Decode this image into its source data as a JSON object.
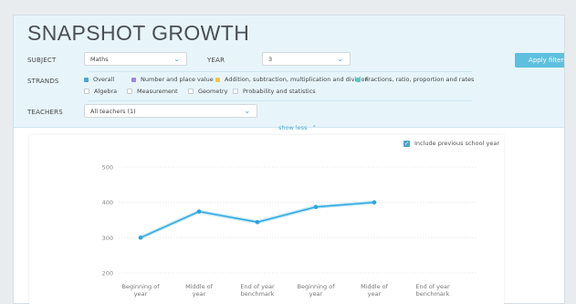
{
  "header": {
    "title": "SNAPSHOT GROWTH"
  },
  "filters": {
    "subject_label": "SUBJECT",
    "subject_value": "Maths",
    "year_label": "YEAR",
    "year_value": "3",
    "apply_label": "Apply filters",
    "strands_label": "STRANDS",
    "strands": [
      {
        "label": "Overall",
        "color": "#4ea6c7",
        "checked": true
      },
      {
        "label": "Number and place value",
        "color": "#9b86d6",
        "checked": true
      },
      {
        "label": "Addition, subtraction, multiplication and division",
        "color": "#f2c744",
        "checked": true
      },
      {
        "label": "Fractions, ratio, proportion and rates",
        "color": "#5cc7c2",
        "checked": true
      },
      {
        "label": "Algebra",
        "checked": false
      },
      {
        "label": "Measurement",
        "checked": false
      },
      {
        "label": "Geometry",
        "checked": false
      },
      {
        "label": "Probability and statistics",
        "checked": false
      }
    ],
    "teachers_label": "TEACHERS",
    "teachers_value": "All teachers (1)",
    "show_less": "show less"
  },
  "chart": {
    "include_previous_label": "Include previous school year",
    "include_previous_checked": true
  },
  "chart_data": {
    "type": "line",
    "categories": [
      [
        "Beginning of",
        "year"
      ],
      [
        "Middle of",
        "year"
      ],
      [
        "End of year",
        "benchmark"
      ],
      [
        "Beginning of",
        "year"
      ],
      [
        "Middle of",
        "year"
      ],
      [
        "End of year",
        "benchmark"
      ]
    ],
    "series": [
      {
        "values": [
          300,
          374,
          344,
          387,
          400,
          null
        ],
        "color": "#2aa6de"
      }
    ],
    "yticks": [
      200,
      300,
      400,
      500
    ],
    "ylim": [
      200,
      500
    ],
    "grid": true
  }
}
